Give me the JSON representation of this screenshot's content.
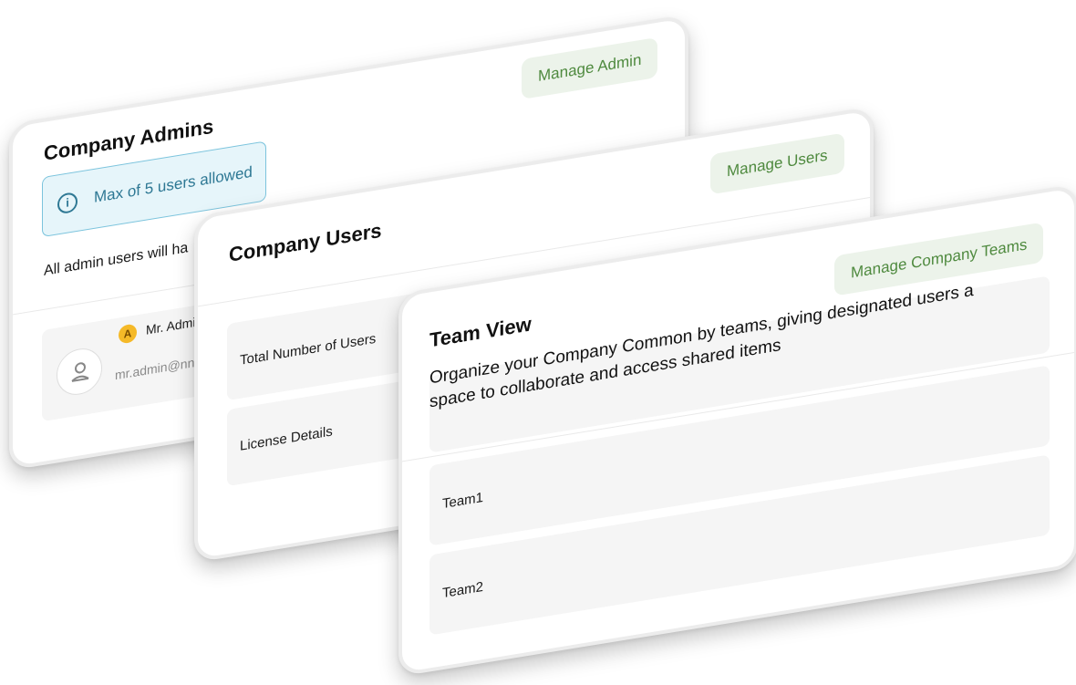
{
  "admins_card": {
    "title": "Company Admins",
    "manage_label": "Manage Admin",
    "info_text": "Max of 5 users allowed",
    "info_icon": "info-icon",
    "description": "All admin users will ha",
    "admin_entry": {
      "badge": "A",
      "name": "Mr. Admi",
      "email": "mr.admin@nn",
      "avatar_icon": "user-icon"
    }
  },
  "users_card": {
    "title": "Company Users",
    "manage_label": "Manage Users",
    "rows": [
      {
        "label": "Total Number of Users"
      },
      {
        "label": "License Details"
      }
    ]
  },
  "team_card": {
    "title": "Team View",
    "manage_label": "Manage Company Teams",
    "description": "Organize your Company Common by teams, giving designated users a space to collaborate and access shared items",
    "teams": [
      {
        "label": "Team1"
      },
      {
        "label": "Team2"
      }
    ]
  },
  "colors": {
    "accent_green": "#4f8a3f",
    "button_bg": "#ecf3ea",
    "info_blue": "#2e7894",
    "info_bg": "#e6f5fa"
  }
}
